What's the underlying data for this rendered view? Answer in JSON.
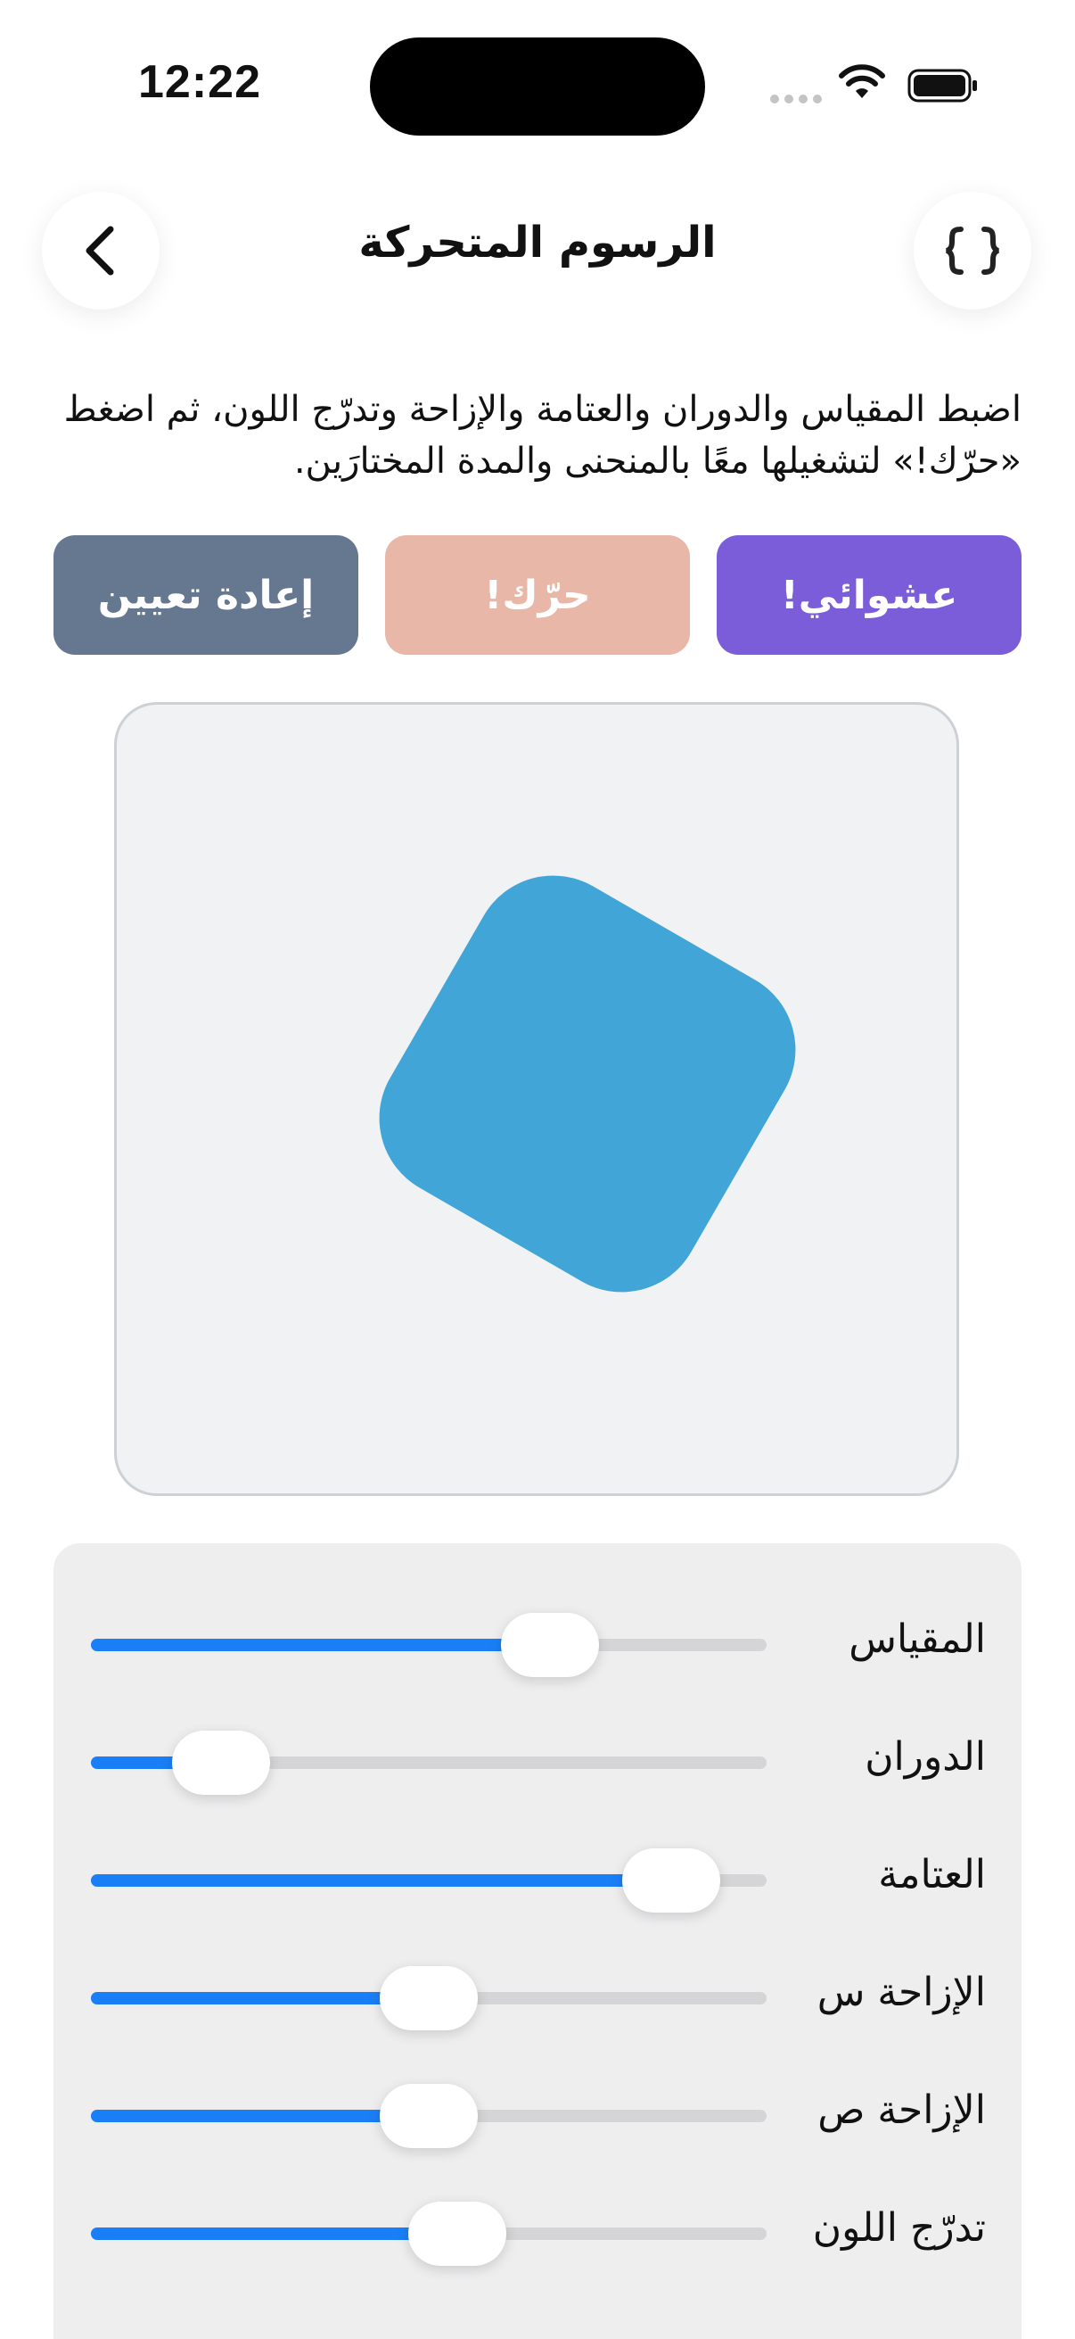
{
  "status_bar": {
    "time": "12:22"
  },
  "header": {
    "title": "الرسوم المتحركة",
    "back_icon": "chevron-left-icon",
    "code_icon": "curly-braces-icon"
  },
  "description": "اضبط المقياس والدوران والعتامة والإزاحة وتدرّج اللون، ثم اضغط «حرّك!» لتشغيلها معًا بالمنحنى والمدة المختارَين.",
  "buttons": {
    "random": "عشوائي!",
    "animate": "حرّك!",
    "reset": "إعادة تعيين"
  },
  "colors": {
    "random_button": "#7c5dd9",
    "animate_button": "#e8b7a8",
    "reset_button": "#667790",
    "shape": "#42a5d8",
    "slider_fill": "#1a7ff7"
  },
  "sliders": [
    {
      "label": "المقياس",
      "value": 0.71
    },
    {
      "label": "الدوران",
      "value": 0.14
    },
    {
      "label": "العتامة",
      "value": 0.92
    },
    {
      "label": "الإزاحة س",
      "value": 0.5
    },
    {
      "label": "الإزاحة ص",
      "value": 0.5
    },
    {
      "label": "تدرّج اللون",
      "value": 0.55
    }
  ]
}
